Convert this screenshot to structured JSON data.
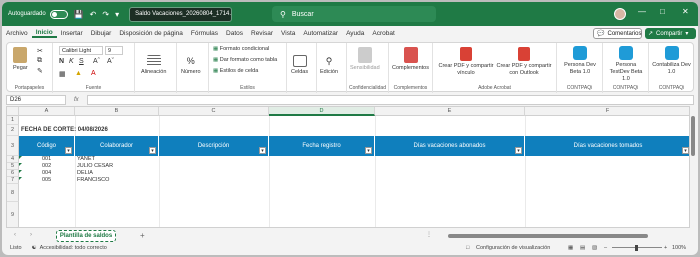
{
  "titlebar": {
    "autosave_label": "Autoguardado",
    "filename": "Saldo Vacaciones_20260804_1714...",
    "search_placeholder": "Buscar"
  },
  "menu": [
    "Archivo",
    "Inicio",
    "Insertar",
    "Dibujar",
    "Disposición de página",
    "Fórmulas",
    "Datos",
    "Revisar",
    "Vista",
    "Automatizar",
    "Ayuda",
    "Acrobat"
  ],
  "header_buttons": {
    "comments": "Comentarios",
    "share": "Compartir"
  },
  "ribbon": {
    "paste": "Pegar",
    "clipboard_group": "Portapapeles",
    "font_name": "Calibri Light",
    "font_size": "9",
    "font_group": "Fuente",
    "alignment": "Alineación",
    "number": "Número",
    "cond_format": "Formato condicional",
    "table_format": "Dar formato como tabla",
    "cell_styles": "Estilos de celda",
    "styles_group": "Estilos",
    "cells": "Celdas",
    "editing": "Edición",
    "sensitivity": "Sensibilidad",
    "confidentiality_group": "Confidencialidad",
    "addins": "Complementos",
    "addins_group": "Complementos",
    "pdf_link": "Crear PDF y compartir vínculo",
    "pdf_outlook": "Crear PDF y compartir con Outlook",
    "acrobat_group": "Adobe Acrobat",
    "persona_beta": "Persona Dev Beta 1.0",
    "persona_testdev": "Persona TestDev Beta 1.0",
    "contabiliza": "Contabiliza Dev 1.0",
    "contpaqi": "CONTPAQi"
  },
  "formula_bar": {
    "name_box": "D26",
    "fx": "fx",
    "content": ""
  },
  "columns": [
    "A",
    "B",
    "C",
    "D",
    "E",
    "F"
  ],
  "rows": [
    "1",
    "2",
    "3",
    "4",
    "5",
    "6",
    "7",
    "8",
    "9"
  ],
  "fecha_corte": "FECHA DE CORTE: 04/08/2026",
  "table_headers": [
    "Código",
    "Colaborador",
    "Descripción",
    "Fecha registro",
    "Días vacaciones abonados",
    "Días vacaciones tomados"
  ],
  "table_rows": [
    {
      "codigo": "001",
      "colaborador": "YANET"
    },
    {
      "codigo": "002",
      "colaborador": "JULIO CESAR"
    },
    {
      "codigo": "004",
      "colaborador": "DELIA"
    },
    {
      "codigo": "005",
      "colaborador": "FRANCISCO"
    }
  ],
  "sheet_tab": "Plantilla de saldos",
  "status": {
    "ready": "Listo",
    "accessibility": "Accesibilidad: todo correcto",
    "display_settings": "Configuración de visualización",
    "zoom": "100%"
  }
}
